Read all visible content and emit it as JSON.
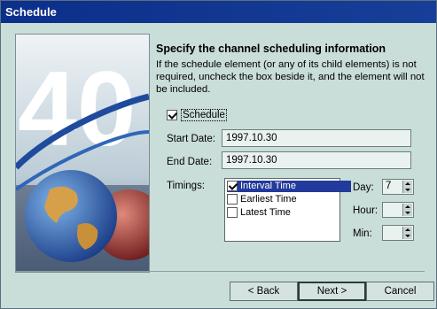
{
  "window": {
    "title": "Schedule"
  },
  "art": {
    "graphic_text": "40",
    "icon": "globe-illustration"
  },
  "heading": "Specify the channel scheduling information",
  "description": "If the schedule element (or any of its child elements) is not required, uncheck the box beside it, and the element will not be included.",
  "schedule_checkbox": {
    "label": "Schedule",
    "checked": true
  },
  "start_date": {
    "label": "Start Date:",
    "value": "1997.10.30"
  },
  "end_date": {
    "label": "End Date:",
    "value": "1997.10.30"
  },
  "timings": {
    "label": "Timings:",
    "items": [
      {
        "label": "Interval Time",
        "checked": true,
        "selected": true
      },
      {
        "label": "Earliest Time",
        "checked": false,
        "selected": false
      },
      {
        "label": "Latest Time",
        "checked": false,
        "selected": false
      }
    ]
  },
  "interval": {
    "day": {
      "label": "Day:",
      "value": "7"
    },
    "hour": {
      "label": "Hour:",
      "value": ""
    },
    "min": {
      "label": "Min:",
      "value": ""
    }
  },
  "buttons": {
    "back": "< Back",
    "next": "Next >",
    "cancel": "Cancel"
  }
}
